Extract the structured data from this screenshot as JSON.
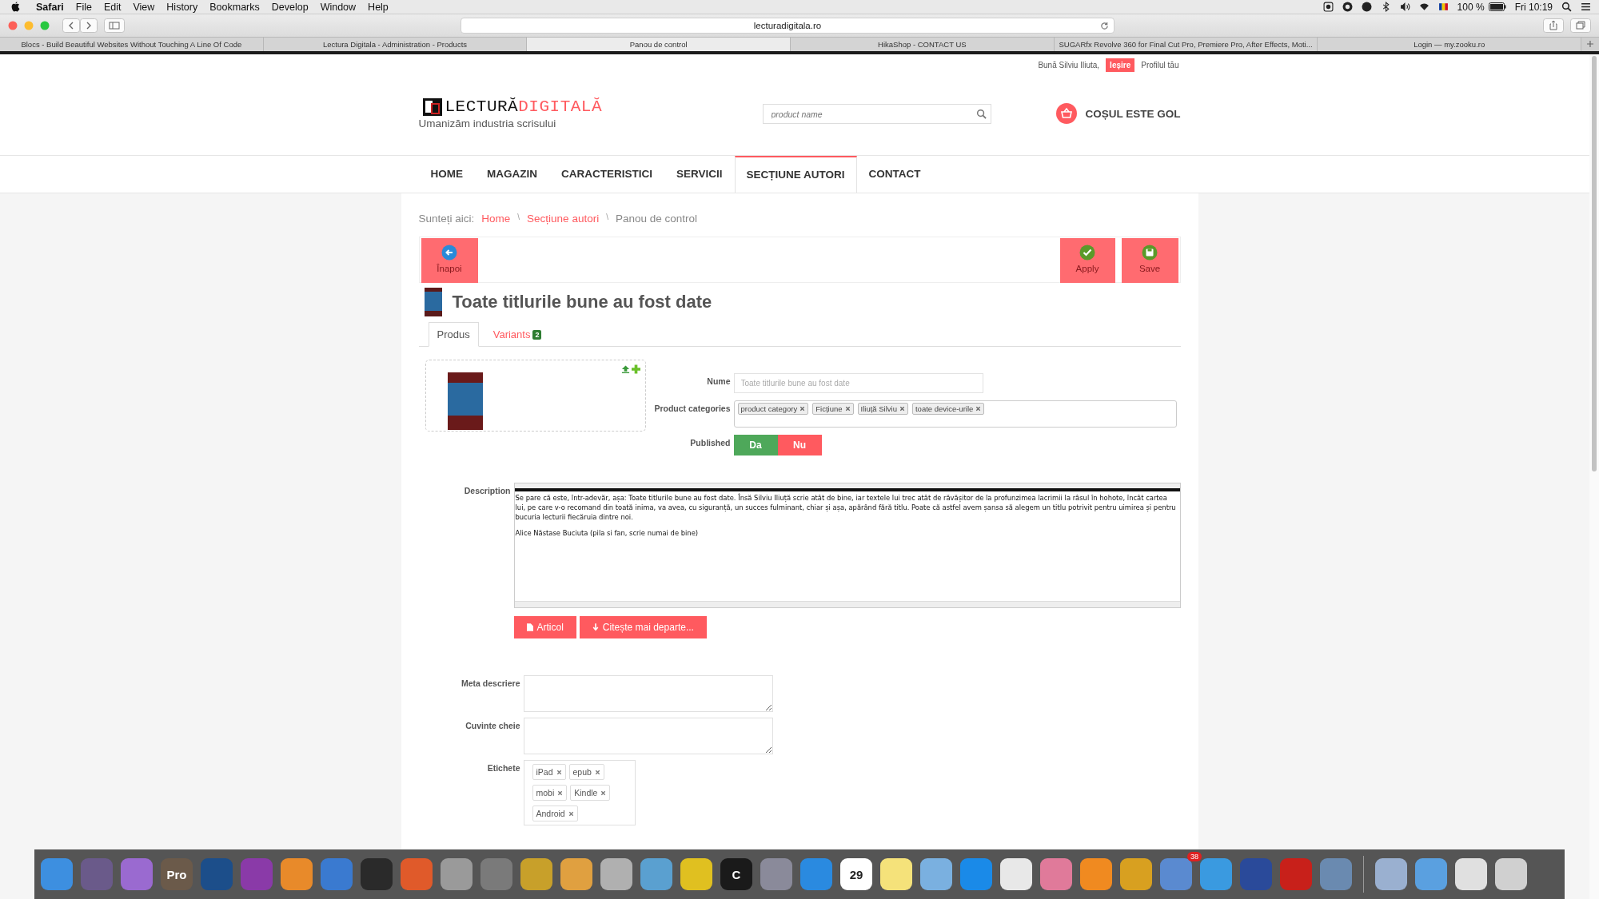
{
  "menubar": {
    "app": "Safari",
    "menus": [
      "File",
      "Edit",
      "View",
      "History",
      "Bookmarks",
      "Develop",
      "Window",
      "Help"
    ],
    "battery": "100 %",
    "clock": "Fri 10:19"
  },
  "browser": {
    "address": "lecturadigitala.ro",
    "tabs": [
      {
        "title": "Blocs - Build Beautiful Websites Without Touching A Line Of Code",
        "selected": false
      },
      {
        "title": "Lectura Digitala - Administration - Products",
        "selected": false
      },
      {
        "title": "Panou de control",
        "selected": true
      },
      {
        "title": "HikaShop - CONTACT US",
        "selected": false
      },
      {
        "title": "SUGARfx Revolve 360 for Final Cut Pro, Premiere Pro, After Effects, Moti...",
        "selected": false
      },
      {
        "title": "Login — my.zooku.ro",
        "selected": false
      }
    ]
  },
  "site": {
    "greeting": "Bună Silviu Iliuta,",
    "logout": "Ieșire",
    "profile": "Profilul tău",
    "logo": {
      "word1": "LECTURĂ",
      "word2": "DIGITALĂ",
      "tagline": "Umanizăm industria scrisului"
    },
    "search": {
      "placeholder": "product name"
    },
    "cart": "COȘUL ESTE GOL",
    "nav": [
      {
        "label": "HOME",
        "selected": false
      },
      {
        "label": "MAGAZIN",
        "selected": false
      },
      {
        "label": "CARACTERISTICI",
        "selected": false
      },
      {
        "label": "SERVICII",
        "selected": false
      },
      {
        "label": "SECȚIUNE AUTORI",
        "selected": true
      },
      {
        "label": "CONTACT",
        "selected": false
      }
    ],
    "breadcrumb": {
      "prefix": "Sunteți aici:",
      "separator": "\\",
      "items": [
        {
          "label": "Home",
          "kind": "link"
        },
        {
          "label": "Secțiune autori",
          "kind": "link"
        },
        {
          "label": "Panou de control",
          "kind": "current"
        }
      ]
    }
  },
  "toolbar": [
    {
      "label": "Înapoi",
      "kind": "back"
    },
    {
      "label": "Apply",
      "kind": "apply"
    },
    {
      "label": "Save",
      "kind": "save"
    }
  ],
  "product": {
    "title": "Toate titlurile bune au fost date",
    "tabs": [
      {
        "label": "Produs",
        "selected": true
      },
      {
        "label": "Variants",
        "badge": "2",
        "selected": false
      }
    ],
    "name_label": "Nume",
    "name_placeholder": "Toate titlurile bune au fost date",
    "categories_label": "Product categories",
    "categories": [
      "product category",
      "Ficțiune",
      "Iliuță Silviu",
      "toate device-urile"
    ],
    "published_label": "Published",
    "published_options": [
      {
        "label": "Da",
        "color": "#4ea85a"
      },
      {
        "label": "Nu",
        "color": "#ff5a5f"
      }
    ],
    "description_label": "Description",
    "description": [
      "Se pare că este, într-adevăr, așa: Toate titlurile bune au fost date. Însă Silviu Iliuță scrie atât de bine, iar textele lui trec atât de răvășitor de la profunzimea lacrimii la râsul în hohote, încât cartea lui, pe care v-o recomand din toată inima, va avea, cu siguranță, un succes fulminant, chiar și așa, apărând fără titlu. Poate că astfel avem șansa să alegem un titlu potrivit pentru uimirea și pentru bucuria lecturii fiecăruia dintre noi.",
      "Alice Năstase Buciuta (pila si fan, scrie numai de bine)"
    ],
    "editor_buttons": [
      {
        "label": "Articol",
        "kind": "document"
      },
      {
        "label": "Citește mai departe...",
        "kind": "readmore"
      }
    ],
    "meta_label": "Meta descriere",
    "keywords_label": "Cuvinte cheie",
    "tags_label": "Etichete",
    "tags": [
      "iPad",
      "epub",
      "mobi",
      "Kindle",
      "Android"
    ]
  },
  "dock": [
    {
      "color": "#3d8fe0"
    },
    {
      "color": "#6a5a8a"
    },
    {
      "color": "#9a6ad0"
    },
    {
      "color": "#6b5a4a",
      "text": "Pro"
    },
    {
      "color": "#1c4e8a"
    },
    {
      "color": "#8a3aa8"
    },
    {
      "color": "#e88a2a"
    },
    {
      "color": "#3a7ad0"
    },
    {
      "color": "#2a2a2a"
    },
    {
      "color": "#e05a2a"
    },
    {
      "color": "#9a9a9a"
    },
    {
      "color": "#7a7a7a"
    },
    {
      "color": "#c8a02a"
    },
    {
      "color": "#e0a040"
    },
    {
      "color": "#b0b0b0"
    },
    {
      "color": "#5aa0d0"
    },
    {
      "color": "#e0c020"
    },
    {
      "color": "#1a1a1a",
      "text": "C"
    },
    {
      "color": "#8a8a9a"
    },
    {
      "color": "#2a8ae0"
    },
    {
      "color": "#ffffff",
      "text": "29"
    },
    {
      "color": "#f5e27a"
    },
    {
      "color": "#7ab0e0"
    },
    {
      "color": "#1a8ae8"
    },
    {
      "color": "#e8e8e8"
    },
    {
      "color": "#e07a9a"
    },
    {
      "color": "#f08a20"
    },
    {
      "color": "#d8a020"
    },
    {
      "color": "#5a8ad0",
      "badge": "38"
    },
    {
      "color": "#3a9ae0"
    },
    {
      "color": "#2a4a9a"
    },
    {
      "color": "#c8201a"
    },
    {
      "color": "#6a8ab0"
    },
    {
      "color": "#9ab0d0"
    },
    {
      "color": "#5aa0e0"
    },
    {
      "color": "#e0e0e0"
    },
    {
      "color": "#d0d0d0"
    }
  ]
}
